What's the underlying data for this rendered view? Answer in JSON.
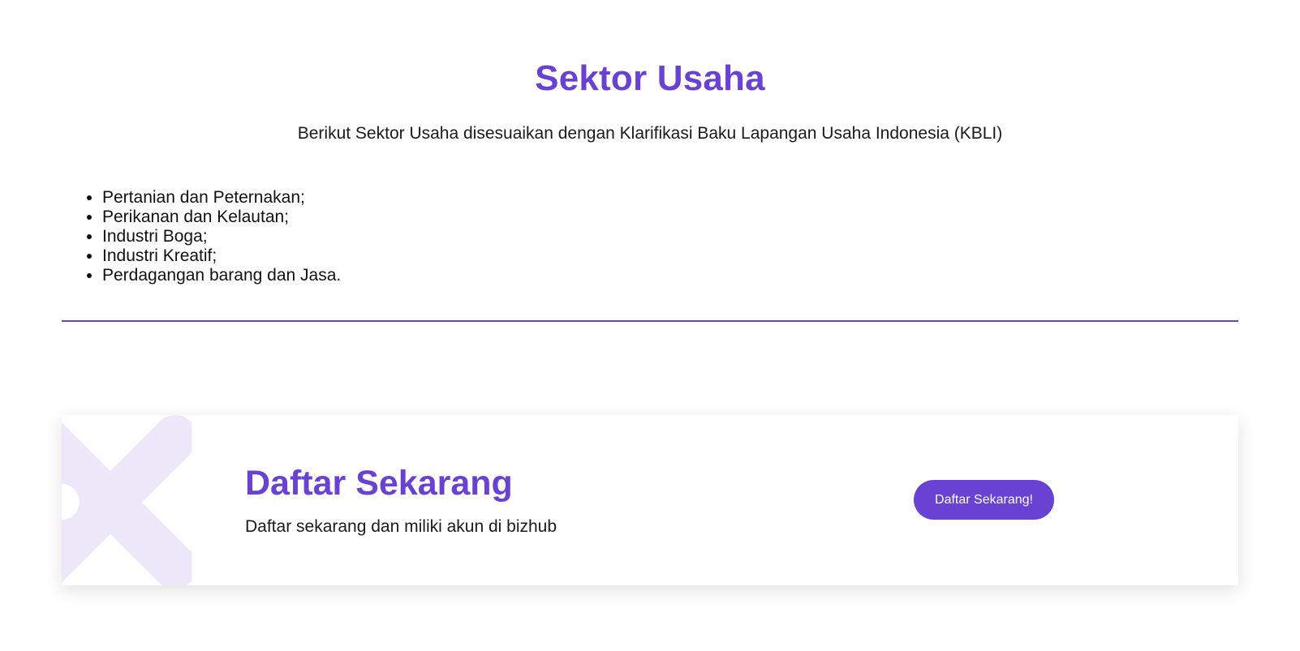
{
  "section": {
    "title": "Sektor Usaha",
    "subtitle": "Berikut Sektor Usaha disesuaikan dengan Klarifikasi Baku Lapangan Usaha Indonesia (KBLI)",
    "items": [
      "Pertanian dan Peternakan;",
      "Perikanan dan Kelautan;",
      "Industri Boga;",
      "Industri Kreatif;",
      "Perdagangan barang dan Jasa."
    ]
  },
  "cta": {
    "title": "Daftar Sekarang",
    "text": "Daftar sekarang dan miliki akun di bizhub",
    "button_label": "Daftar Sekarang!",
    "decor_icon": "x-shape-icon"
  },
  "colors": {
    "accent": "#6a42d3",
    "decor": "#ece8fa",
    "text": "#111111",
    "background": "#ffffff"
  }
}
